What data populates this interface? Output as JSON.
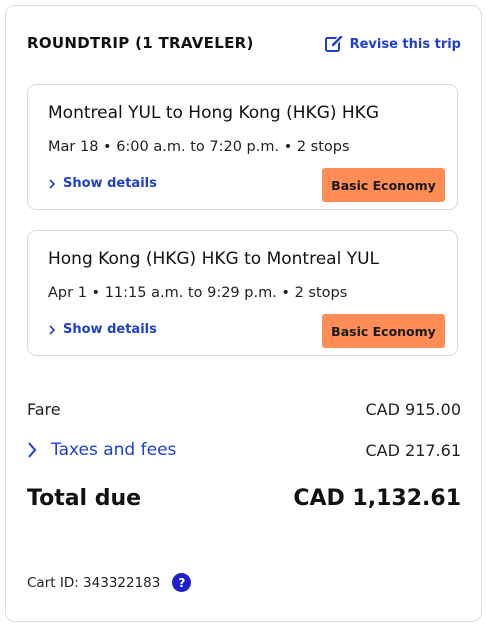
{
  "header": {
    "trip_type": "ROUNDTRIP (1 TRAVELER)",
    "revise_label": "Revise this trip",
    "revise_icon": "edit-icon"
  },
  "legs": [
    {
      "route": "Montreal YUL to Hong Kong (HKG) HKG",
      "times": "Mar 18 • 6:00 a.m. to 7:20 p.m. • 2 stops",
      "details_label": "Show details",
      "fare_class": "Basic Economy"
    },
    {
      "route": "Hong Kong (HKG) HKG to Montreal YUL",
      "times": "Apr 1 • 11:15 a.m. to 9:29 p.m. • 2 stops",
      "details_label": "Show details",
      "fare_class": "Basic Economy"
    }
  ],
  "pricing": {
    "fare_label": "Fare",
    "fare_amount": "CAD 915.00",
    "taxes_label": "Taxes and fees",
    "taxes_amount": "CAD 217.61",
    "total_label": "Total due",
    "total_amount": "CAD 1,132.61"
  },
  "cart": {
    "id_text": "Cart ID: 343322183",
    "help_glyph": "?"
  },
  "colors": {
    "accent": "#1f3fcf",
    "badge": "#ff8d55",
    "help": "#1f1fcc"
  }
}
